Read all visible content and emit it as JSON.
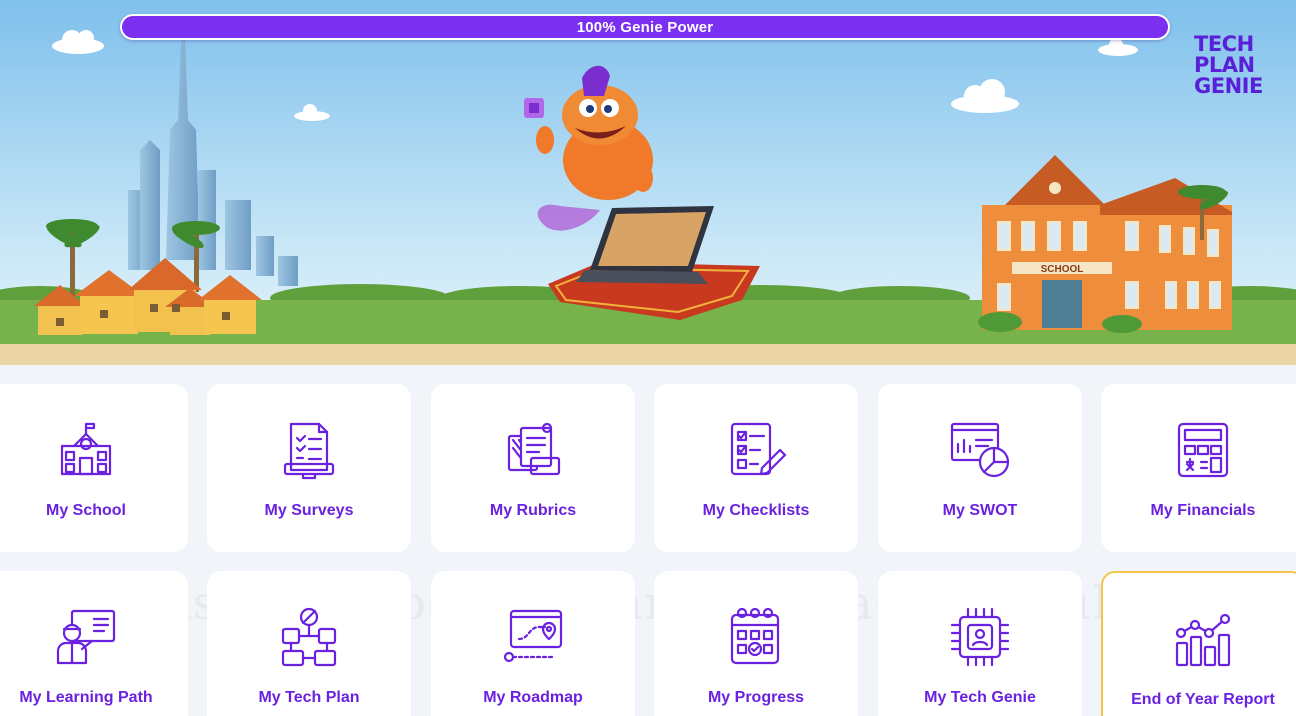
{
  "progress": {
    "label": "100% Genie Power",
    "value": 1.0
  },
  "logo": {
    "lines": [
      "TECH",
      "PLAN",
      "GENIE"
    ]
  },
  "hero": {
    "school_sign": "SCHOOL"
  },
  "watermark": "As You Progress Through Each Module",
  "modules": [
    {
      "label": "My School",
      "icon": "school-building-icon"
    },
    {
      "label": "My Surveys",
      "icon": "survey-clipboard-icon"
    },
    {
      "label": "My Rubrics",
      "icon": "rubric-documents-icon"
    },
    {
      "label": "My Checklists",
      "icon": "checklist-pencil-icon"
    },
    {
      "label": "My SWOT",
      "icon": "swot-chart-icon"
    },
    {
      "label": "My Financials",
      "icon": "calculator-icon"
    },
    {
      "label": "My Learning Path",
      "icon": "teacher-board-icon"
    },
    {
      "label": "My Tech Plan",
      "icon": "flowchart-icon"
    },
    {
      "label": "My Roadmap",
      "icon": "roadmap-icon"
    },
    {
      "label": "My Progress",
      "icon": "calendar-progress-icon"
    },
    {
      "label": "My Tech Genie",
      "icon": "chip-genie-icon"
    },
    {
      "label": "End of Year Report",
      "icon": "report-chart-icon"
    }
  ],
  "colors": {
    "accent": "#6a22e0",
    "progress_fill": "#7b2ff0",
    "highlight_border": "#f3c54a"
  }
}
